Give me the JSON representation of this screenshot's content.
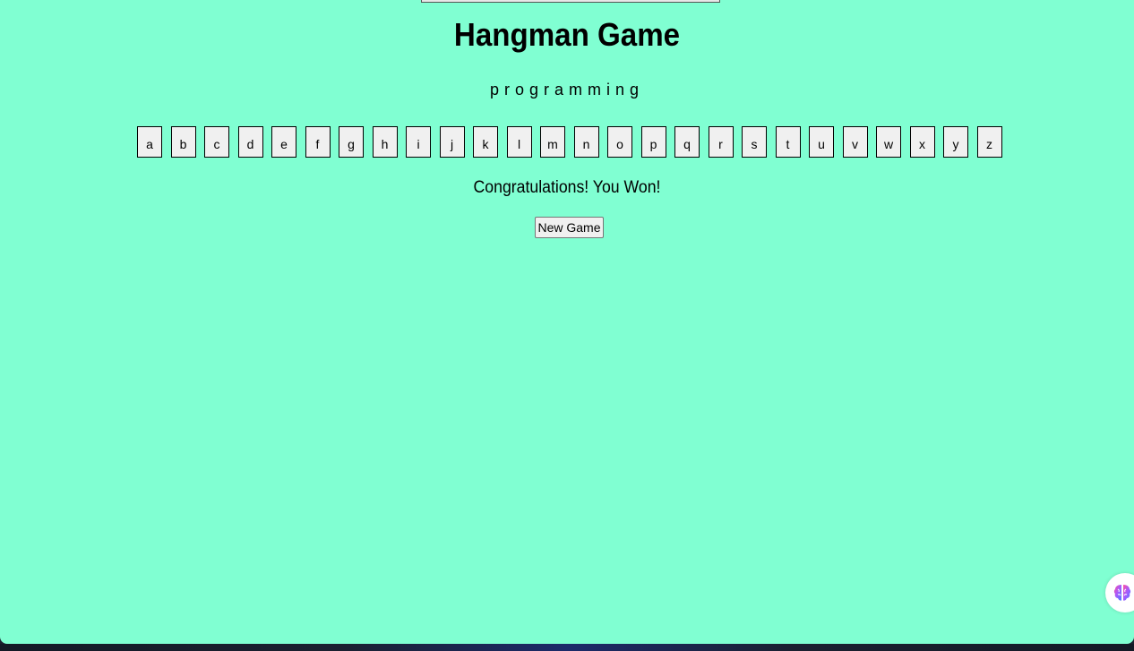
{
  "title": "Hangman Game",
  "word_display": "programming",
  "letters": [
    "a",
    "b",
    "c",
    "d",
    "e",
    "f",
    "g",
    "h",
    "i",
    "j",
    "k",
    "l",
    "m",
    "n",
    "o",
    "p",
    "q",
    "r",
    "s",
    "t",
    "u",
    "v",
    "w",
    "x",
    "y",
    "z"
  ],
  "status_message": "Congratulations! You Won!",
  "new_game_label": "New Game",
  "colors": {
    "background": "#80ffd2",
    "button_bg": "#f0f0f0",
    "text": "#000000"
  },
  "icons": {
    "extension_widget": "brain-icon"
  }
}
